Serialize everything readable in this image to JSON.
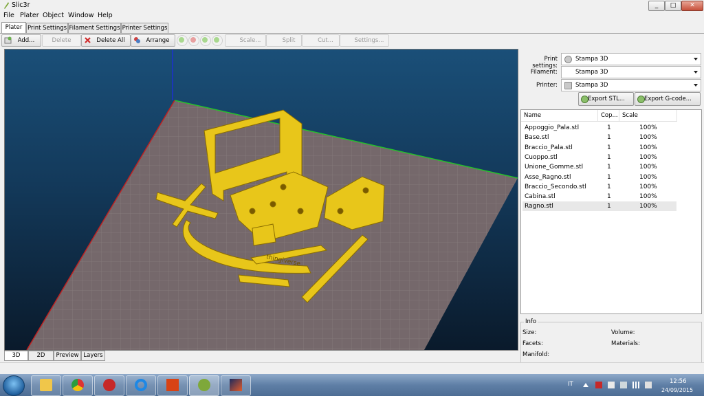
{
  "window": {
    "title": "Slic3r"
  },
  "menubar": [
    "File",
    "Plater",
    "Object",
    "Window",
    "Help"
  ],
  "tabs": [
    "Plater",
    "Print Settings",
    "Filament Settings",
    "Printer Settings"
  ],
  "toolbar": {
    "add": "Add...",
    "delete": "Delete",
    "delete_all": "Delete All",
    "arrange": "Arrange",
    "scale": "Scale...",
    "split": "Split",
    "cut": "Cut...",
    "settings": "Settings..."
  },
  "view_tabs": [
    "3D",
    "2D",
    "Preview",
    "Layers"
  ],
  "print_panel": {
    "print_label": "Print settings:",
    "print_value": "Stampa 3D",
    "filament_label": "Filament:",
    "filament_value": "Stampa 3D",
    "printer_label": "Printer:",
    "printer_value": "Stampa 3D",
    "export_stl": "Export STL...",
    "export_gcode": "Export G-code..."
  },
  "object_list": {
    "columns": [
      "Name",
      "Cop...",
      "Scale"
    ],
    "rows": [
      {
        "name": "Appoggio_Pala.stl",
        "copies": "1",
        "scale": "100%"
      },
      {
        "name": "Base.stl",
        "copies": "1",
        "scale": "100%"
      },
      {
        "name": "Braccio_Pala.stl",
        "copies": "1",
        "scale": "100%"
      },
      {
        "name": "Cuoppo.stl",
        "copies": "1",
        "scale": "100%"
      },
      {
        "name": "Unione_Gomme.stl",
        "copies": "1",
        "scale": "100%"
      },
      {
        "name": "Asse_Ragno.stl",
        "copies": "1",
        "scale": "100%"
      },
      {
        "name": "Braccio_Secondo.stl",
        "copies": "1",
        "scale": "100%"
      },
      {
        "name": "Cabina.stl",
        "copies": "1",
        "scale": "100%"
      },
      {
        "name": "Ragno.stl",
        "copies": "1",
        "scale": "100%"
      }
    ],
    "selected_index": 8
  },
  "info": {
    "title": "Info",
    "size_label": "Size:",
    "volume_label": "Volume:",
    "facets_label": "Facets:",
    "materials_label": "Materials:",
    "manifold_label": "Manifold:"
  },
  "model_text": "thingiverse",
  "taskbar": {
    "apps": [
      "explorer-icon",
      "chrome-icon",
      "pdf-icon",
      "ccleaner-icon",
      "reader-icon",
      "slic3r-icon",
      "media-icon"
    ],
    "language": "IT",
    "time": "12:56",
    "date": "24/09/2015"
  },
  "colors": {
    "model": "#e8c61a",
    "bed": "#7a6b6b",
    "viewport_top": "#1a4f78",
    "viewport_bottom": "#0a1a2b"
  }
}
